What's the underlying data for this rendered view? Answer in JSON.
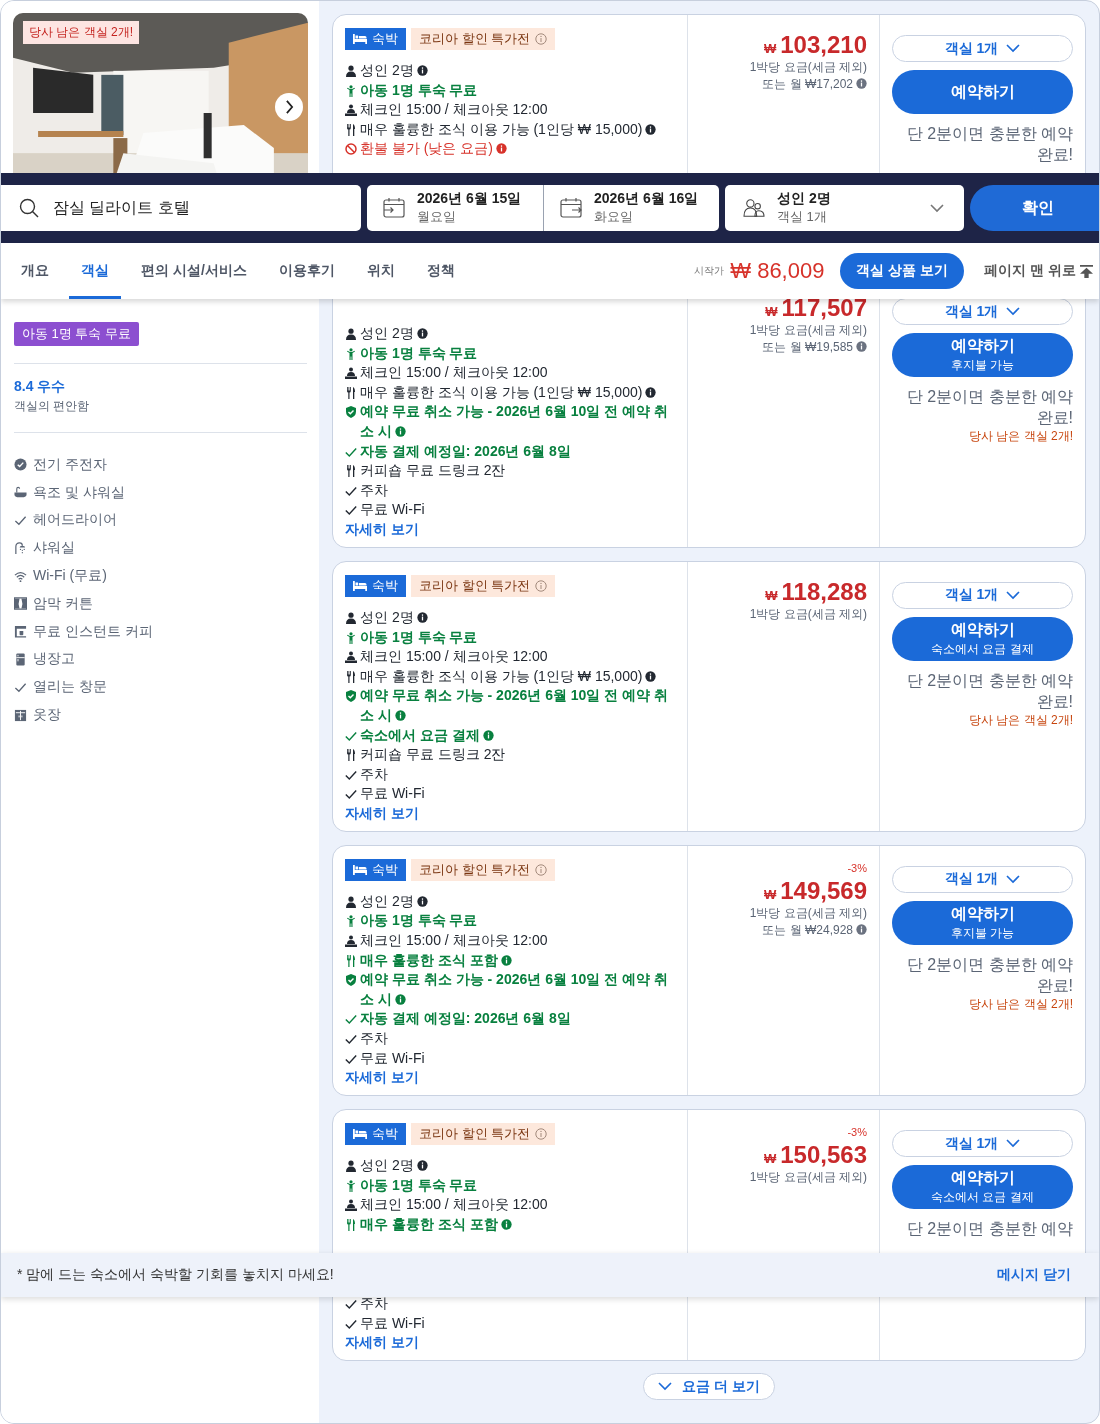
{
  "room_photo": {
    "kind": "picture",
    "badge": "당사 남은 객실 2개!"
  },
  "sidebar": {
    "promo_tag": "아동 1명 투숙 무료",
    "rating": {
      "score": "8.4 우수",
      "label": "객실의 편안함"
    },
    "amenities": [
      {
        "kind": "check-circle",
        "text": "전기 주전자"
      },
      {
        "kind": "bath",
        "text": "욕조 및 샤워실"
      },
      {
        "kind": "check",
        "text": "헤어드라이어"
      },
      {
        "kind": "shower",
        "text": "샤워실"
      },
      {
        "kind": "wifi",
        "text": "Wi-Fi (무료)"
      },
      {
        "kind": "curtain",
        "text": "암막 커튼"
      },
      {
        "kind": "coffee",
        "text": "무료 인스턴트 커피"
      },
      {
        "kind": "fridge",
        "text": "냉장고"
      },
      {
        "kind": "check",
        "text": "열리는 창문"
      },
      {
        "kind": "closet",
        "text": "옷장"
      }
    ]
  },
  "cards": [
    {
      "badges": {
        "stay": "숙박",
        "promo": "코리아 할인 특가전"
      },
      "features": [
        {
          "kind": "person",
          "text": "성인 2명",
          "highlighted": false,
          "warning": false,
          "info": true
        },
        {
          "kind": "child",
          "text": "아동 1명 투숙 무료",
          "highlighted": true,
          "warning": false,
          "info": false
        },
        {
          "kind": "checkin",
          "text": "체크인 15:00 / 체크아웃 12:00",
          "highlighted": false,
          "warning": false,
          "info": false
        },
        {
          "kind": "meal",
          "text": "매우 훌륭한 조식 이용 가능 (1인당 ₩ 15,000)",
          "highlighted": false,
          "warning": false,
          "info": true
        },
        {
          "kind": "refund",
          "text": "환불 불가 (낮은 요금)",
          "highlighted": false,
          "warning": true,
          "info": true
        }
      ],
      "price": {
        "currency": "₩",
        "amount": "103,210",
        "per_night": "1박당 요금(세금 제외)",
        "monthly": "또는 월 ₩17,202"
      },
      "action": {
        "rooms": "객실 1개",
        "book": "예약하기",
        "note": "단 2분이면 충분한 예약 완료!"
      }
    },
    {
      "features": [
        {
          "kind": "person",
          "text": "성인 2명",
          "highlighted": false,
          "warning": false,
          "info": true
        },
        {
          "kind": "child",
          "text": "아동 1명 투숙 무료",
          "highlighted": true,
          "warning": false,
          "info": false
        },
        {
          "kind": "checkin",
          "text": "체크인 15:00 / 체크아웃 12:00",
          "highlighted": false,
          "warning": false,
          "info": false
        },
        {
          "kind": "meal",
          "text": "매우 훌륭한 조식 이용 가능 (1인당 ₩ 15,000)",
          "highlighted": false,
          "warning": false,
          "info": true
        },
        {
          "kind": "shield",
          "text": "예약 무료 취소 가능 - 2026년 6월 10일 전 예약 취소 시",
          "highlighted": true,
          "warning": false,
          "info": true
        },
        {
          "kind": "check",
          "text": "자동 결제 예정일: 2026년 6월 8일",
          "highlighted": true,
          "warning": false,
          "info": false
        },
        {
          "kind": "meal",
          "text": "커피숍 무료 드링크 2잔",
          "highlighted": false,
          "warning": false,
          "info": false
        }
      ],
      "amenities": [
        "주차",
        "무료 Wi-Fi"
      ],
      "details": "자세히 보기",
      "price": {
        "currency": "₩",
        "amount": "117,507",
        "per_night": "1박당 요금(세금 제외)",
        "monthly": "또는 월 ₩19,585"
      },
      "action": {
        "rooms": "객실 1개",
        "book": "예약하기",
        "book_sub": "후지불 가능",
        "note": "단 2분이면 충분한 예약 완료!",
        "urgency": "당사 남은 객실 2개!"
      }
    },
    {
      "badges": {
        "stay": "숙박",
        "promo": "코리아 할인 특가전"
      },
      "features": [
        {
          "kind": "person",
          "text": "성인 2명",
          "highlighted": false,
          "warning": false,
          "info": true
        },
        {
          "kind": "child",
          "text": "아동 1명 투숙 무료",
          "highlighted": true,
          "warning": false,
          "info": false
        },
        {
          "kind": "checkin",
          "text": "체크인 15:00 / 체크아웃 12:00",
          "highlighted": false,
          "warning": false,
          "info": false
        },
        {
          "kind": "meal",
          "text": "매우 훌륭한 조식 이용 가능 (1인당 ₩ 15,000)",
          "highlighted": false,
          "warning": false,
          "info": true
        },
        {
          "kind": "shield",
          "text": "예약 무료 취소 가능 - 2026년 6월 10일 전 예약 취소 시",
          "highlighted": true,
          "warning": false,
          "info": true
        },
        {
          "kind": "check",
          "text": "숙소에서 요금 결제",
          "highlighted": true,
          "warning": false,
          "info": true
        },
        {
          "kind": "meal",
          "text": "커피숍 무료 드링크 2잔",
          "highlighted": false,
          "warning": false,
          "info": false
        }
      ],
      "amenities": [
        "주차",
        "무료 Wi-Fi"
      ],
      "details": "자세히 보기",
      "price": {
        "currency": "₩",
        "amount": "118,288",
        "per_night": "1박당 요금(세금 제외)"
      },
      "action": {
        "rooms": "객실 1개",
        "book": "예약하기",
        "book_sub": "숙소에서 요금 결제",
        "note": "단 2분이면 충분한 예약 완료!",
        "urgency": "당사 남은 객실 2개!"
      }
    },
    {
      "badges": {
        "stay": "숙박",
        "promo": "코리아 할인 특가전"
      },
      "features": [
        {
          "kind": "person",
          "text": "성인 2명",
          "highlighted": false,
          "warning": false,
          "info": true
        },
        {
          "kind": "child",
          "text": "아동 1명 투숙 무료",
          "highlighted": true,
          "warning": false,
          "info": false
        },
        {
          "kind": "checkin",
          "text": "체크인 15:00 / 체크아웃 12:00",
          "highlighted": false,
          "warning": false,
          "info": false
        },
        {
          "kind": "meal",
          "text": "매우 훌륭한 조식 포함",
          "highlighted": true,
          "warning": false,
          "info": true
        },
        {
          "kind": "shield",
          "text": "예약 무료 취소 가능 - 2026년 6월 10일 전 예약 취소 시",
          "highlighted": true,
          "warning": false,
          "info": true
        },
        {
          "kind": "check",
          "text": "자동 결제 예정일: 2026년 6월 8일",
          "highlighted": true,
          "warning": false,
          "info": false
        }
      ],
      "amenities": [
        "주차",
        "무료 Wi-Fi"
      ],
      "details": "자세히 보기",
      "price": {
        "discount": "-3%",
        "currency": "₩",
        "amount": "149,569",
        "per_night": "1박당 요금(세금 제외)",
        "monthly": "또는 월 ₩24,928"
      },
      "action": {
        "rooms": "객실 1개",
        "book": "예약하기",
        "book_sub": "후지불 가능",
        "note": "단 2분이면 충분한 예약 완료!",
        "urgency": "당사 남은 객실 2개!"
      }
    },
    {
      "badges": {
        "stay": "숙박",
        "promo": "코리아 할인 특가전"
      },
      "features": [
        {
          "kind": "person",
          "text": "성인 2명",
          "highlighted": false,
          "warning": false,
          "info": true
        },
        {
          "kind": "child",
          "text": "아동 1명 투숙 무료",
          "highlighted": true,
          "warning": false,
          "info": false
        },
        {
          "kind": "checkin",
          "text": "체크인 15:00 / 체크아웃 12:00",
          "highlighted": false,
          "warning": false,
          "info": false
        },
        {
          "kind": "meal",
          "text": "매우 훌륭한 조식 포함",
          "highlighted": true,
          "warning": false,
          "info": true
        }
      ],
      "amenities": [
        "주차",
        "무료 Wi-Fi"
      ],
      "details": "자세히 보기",
      "price": {
        "discount": "-3%",
        "currency": "₩",
        "amount": "150,563",
        "per_night": "1박당 요금(세금 제외)"
      },
      "action": {
        "rooms": "객실 1개",
        "book": "예약하기",
        "book_sub": "숙소에서 요금 결제",
        "note": "단 2분이면 충분한 예약"
      }
    }
  ],
  "more_rates": "요금 더 보기",
  "search_bar": {
    "destination": "잠실 딜라이트 호텔",
    "checkin": {
      "date": "2026년 6월 15일",
      "weekday": "월요일"
    },
    "checkout": {
      "date": "2026년 6월 16일",
      "weekday": "화요일"
    },
    "guests": {
      "adults": "성인 2명",
      "rooms": "객실 1개"
    },
    "submit": "확인"
  },
  "nav": {
    "tabs": [
      {
        "label": "개요",
        "selected": false
      },
      {
        "label": "객실",
        "selected": true
      },
      {
        "label": "편의 시설/서비스",
        "selected": false
      },
      {
        "label": "이용후기",
        "selected": false
      },
      {
        "label": "위치",
        "selected": false
      },
      {
        "label": "정책",
        "selected": false
      }
    ],
    "from_label": "시작가",
    "currency": "₩",
    "from_price": "86,009",
    "view_rooms": "객실 상품 보기",
    "top_link": "페이지 맨 위로"
  },
  "notice": {
    "text": "* 맘에 드는 숙소에서 숙박할 기회를 놓치지 마세요!",
    "close": "메시지 닫기"
  }
}
